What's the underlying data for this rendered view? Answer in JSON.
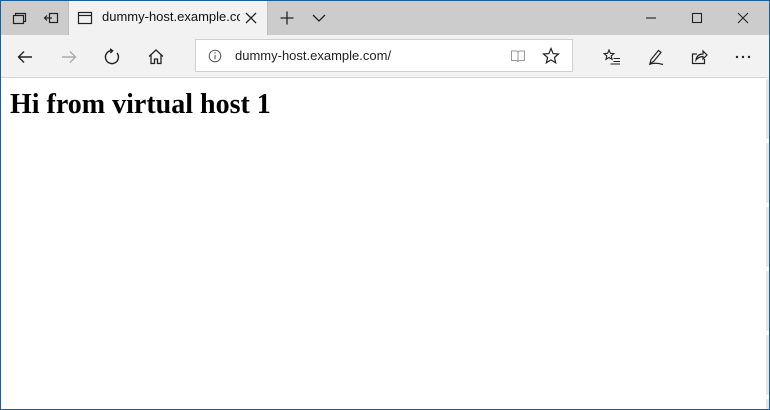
{
  "tab": {
    "title": "dummy-host.example.com"
  },
  "address_bar": {
    "url": "dummy-host.example.com/"
  },
  "page": {
    "heading": "Hi from virtual host 1"
  },
  "icons": {
    "tabstrip": [
      "tabs-aside-icon",
      "restore-tabs-icon",
      "page-icon",
      "close-icon",
      "plus-icon",
      "chevron-down-icon"
    ],
    "window_controls": [
      "minimize-icon",
      "maximize-icon",
      "close-icon"
    ],
    "navbar": [
      "back-arrow-icon",
      "forward-arrow-icon",
      "refresh-icon",
      "home-icon",
      "info-icon",
      "reading-view-icon",
      "star-icon",
      "favorites-list-icon",
      "pen-icon",
      "share-icon",
      "more-icon"
    ]
  },
  "colors": {
    "tabstrip": "#cccccc",
    "active_tab": "#f2f2f2",
    "window_border": "#1b5e9a"
  }
}
